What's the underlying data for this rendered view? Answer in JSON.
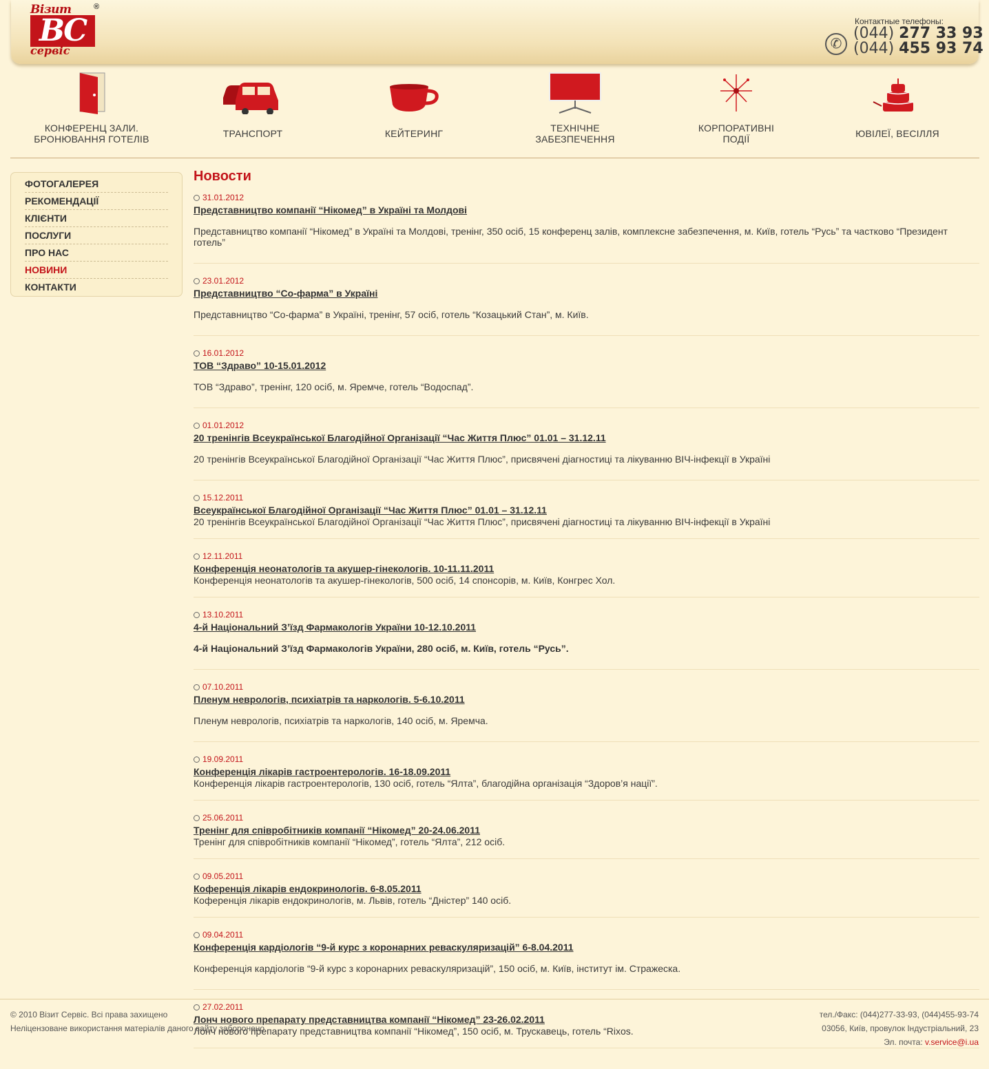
{
  "header": {
    "logo_top": "Візит",
    "logo_mark": "ВС",
    "logo_bottom": "сервіс",
    "logo_registered": "®",
    "phones_label": "Контактные телефоны:",
    "phone1_code": "(044) ",
    "phone1_num": "277 33 93",
    "phone2_code": "(044) ",
    "phone2_num": "455 93 74",
    "phone_icon": "phone-icon"
  },
  "services": [
    {
      "label": "КОНФЕРЕНЦ ЗАЛИ.\nБРОНЮВАННЯ ГОТЕЛІВ",
      "icon": "door-icon"
    },
    {
      "label": "ТРАНСПОРТ",
      "icon": "cars-icon"
    },
    {
      "label": "КЕЙТЕРИНГ",
      "icon": "cup-icon"
    },
    {
      "label": "ТЕХНІЧНЕ\nЗАБЕЗПЕЧЕННЯ",
      "icon": "projector-screen-icon"
    },
    {
      "label": "КОРПОРАТИВНІ\nПОДІЇ",
      "icon": "fireworks-icon"
    },
    {
      "label": "ЮВІЛЕЇ, ВЕСІЛЛЯ",
      "icon": "cake-icon"
    }
  ],
  "sidebar": {
    "items": [
      {
        "label": "ФОТОГАЛЕРЕЯ",
        "active": false
      },
      {
        "label": "РЕКОМЕНДАЦІЇ",
        "active": false
      },
      {
        "label": "КЛІЄНТИ",
        "active": false
      },
      {
        "label": "ПОСЛУГИ",
        "active": false
      },
      {
        "label": "ПРО НАС",
        "active": false
      },
      {
        "label": "НОВИНИ",
        "active": true
      },
      {
        "label": "КОНТАКТИ",
        "active": false
      }
    ]
  },
  "main": {
    "title": "Новости",
    "news": [
      {
        "date": "31.01.2012",
        "title": "Представництво компанії “Нікомед” в Україні та Молдові",
        "text": "Представництво компанії “Нікомед” в Україні та Молдові, тренінг, 350 осіб, 15 конференц залів, комплексне забезпечення, м. Київ, готель “Русь” та частково “Президент готель”",
        "gap": true,
        "bold": false
      },
      {
        "date": "23.01.2012",
        "title": "Представництво “Со-фарма” в Україні",
        "text": "Представництво “Со-фарма” в Україні, тренінг, 57 осіб, готель “Козацький Стан”, м. Київ.",
        "gap": true,
        "bold": false
      },
      {
        "date": "16.01.2012",
        "title": "ТОВ “Здраво” 10-15.01.2012",
        "text": "ТОВ “Здраво”, тренінг, 120 осіб, м. Яремче, готель “Водоспад”.",
        "gap": true,
        "bold": false
      },
      {
        "date": "01.01.2012",
        "title": "20 тренінгів Всеукраїнської Благодійної Організації “Час Життя Плюс” 01.01 – 31.12.11",
        "text": "20 тренінгів Всеукраїнської Благодійної Організації “Час Життя Плюс”, присвячені діагностиці та лікуванню ВІЧ-інфекції в Україні",
        "gap": true,
        "bold": false
      },
      {
        "date": "15.12.2011",
        "title": "Всеукраїнської Благодійної Організації “Час Життя Плюс” 01.01 – 31.12.11",
        "text": "20 тренінгів Всеукраїнської Благодійної Організації “Час Життя Плюс”, присвячені діагностиці та лікуванню ВІЧ-інфекції в Україні",
        "gap": false,
        "bold": false
      },
      {
        "date": "12.11.2011",
        "title": "Конференція неонатологів та акушер-гінекологів. 10-11.11.2011",
        "text": "Конференція неонатологів та акушер-гінекологів, 500 осіб,  14 спонсорів, м. Київ, Конгрес Хол.",
        "gap": false,
        "bold": false
      },
      {
        "date": "13.10.2011",
        "title": "4-й Національний З’їзд Фармакологів України 10-12.10.2011",
        "text": "4-й Національний З’їзд Фармакологів України, 280 осіб, м. Київ, готель “Русь”.",
        "gap": true,
        "bold": true
      },
      {
        "date": "07.10.2011",
        "title": "Пленум неврологів, психіатрів та наркологів. 5-6.10.2011",
        "text": "Пленум неврологів, психіатрів та наркологів, 140 осіб, м. Яремча.",
        "gap": true,
        "bold": false
      },
      {
        "date": "19.09.2011",
        "title": "Конференція лікарів гастроентерологів. 16-18.09.2011",
        "text": "Конференція лікарів гастроентерологів, 130 осіб, готель “Ялта”, благодійна організація “Здоров’я нації”.",
        "gap": false,
        "bold": false
      },
      {
        "date": "25.06.2011",
        "title": "Тренінг для співробітників компанії “Нікомед” 20-24.06.2011",
        "text": "Тренінг для співробітників компанії “Нікомед”, готель “Ялта”, 212 осіб.",
        "gap": false,
        "bold": false
      },
      {
        "date": "09.05.2011",
        "title": "Коференція лікарів ендокринологів. 6-8.05.2011",
        "text": "Коференція лікарів ендокринологів, м. Львів, готель “Дністер” 140 осіб.",
        "gap": false,
        "bold": false
      },
      {
        "date": "09.04.2011",
        "title": "Конференція кардіологів “9-й курс з коронарних реваскуляризацій” 6-8.04.2011",
        "text": "Конференція кардіологів “9-й курс з коронарних реваскуляризацій”, 150 осіб, м. Київ, інститут ім. Стражеска.",
        "gap": true,
        "bold": false
      },
      {
        "date": "27.02.2011",
        "title": "Лонч нового препарату представництва компанії “Нікомед” 23-26.02.2011",
        "text": "Лонч нового препарату представництва компанії “Нікомед”, 150 осіб, м. Трускавець, готель “Rixos.",
        "gap": false,
        "bold": false
      }
    ]
  },
  "footer": {
    "copyright": "© 2010 Візит Сервіс. Всі права захищено",
    "notice": "Неліцензоване використання матеріалів даного сайту заборонено.",
    "phones": "тел./Факс: (044)277-33-93, (044)455-93-74",
    "address": "03056, Київ, провулок Індустріальний, 23",
    "email_label": "Эл. почта: ",
    "email": "v.service@i.ua"
  },
  "colors": {
    "accent": "#c3141a",
    "background": "#fdf4d9",
    "text": "#3a3a3a"
  }
}
